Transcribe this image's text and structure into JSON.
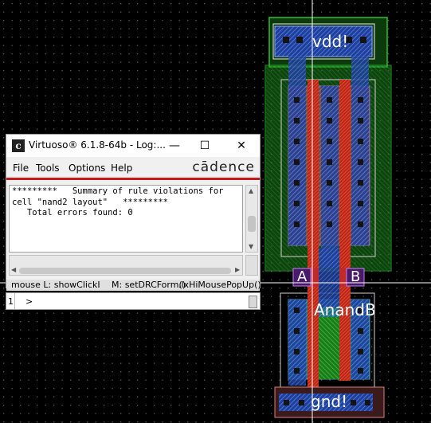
{
  "layout": {
    "net_labels": {
      "vdd": "vdd!",
      "gnd": "gnd!",
      "pin_a": "A",
      "pin_b": "B",
      "output": "AnandB"
    }
  },
  "log_window": {
    "title": "Virtuoso® 6.1.8-64b - Log:...",
    "controls": {
      "minimize": "—",
      "maximize": "☐",
      "close": "✕"
    },
    "menu": [
      {
        "label": "File"
      },
      {
        "label": "Tools"
      },
      {
        "label": "Options"
      },
      {
        "label": "Help"
      }
    ],
    "brand": "cādence",
    "log_text": "*********   Summary of rule violations for\ncell \"nand2 layout\"   *********\n   Total errors found: 0",
    "status": {
      "mouse_l": "mouse L: showClickI",
      "mouse_m": "M: setDRCForm()",
      "mouse_r": ".lxHiMousePopUp()"
    }
  },
  "command_line": {
    "line_number": "1",
    "prompt": ">"
  },
  "colors": {
    "background": "#000000",
    "nwell": "#1ea01e",
    "metal1": "#3a6fd8",
    "poly": "#e03c2a",
    "diffusion": "#b07868",
    "cadence_red": "#c51a1a"
  }
}
